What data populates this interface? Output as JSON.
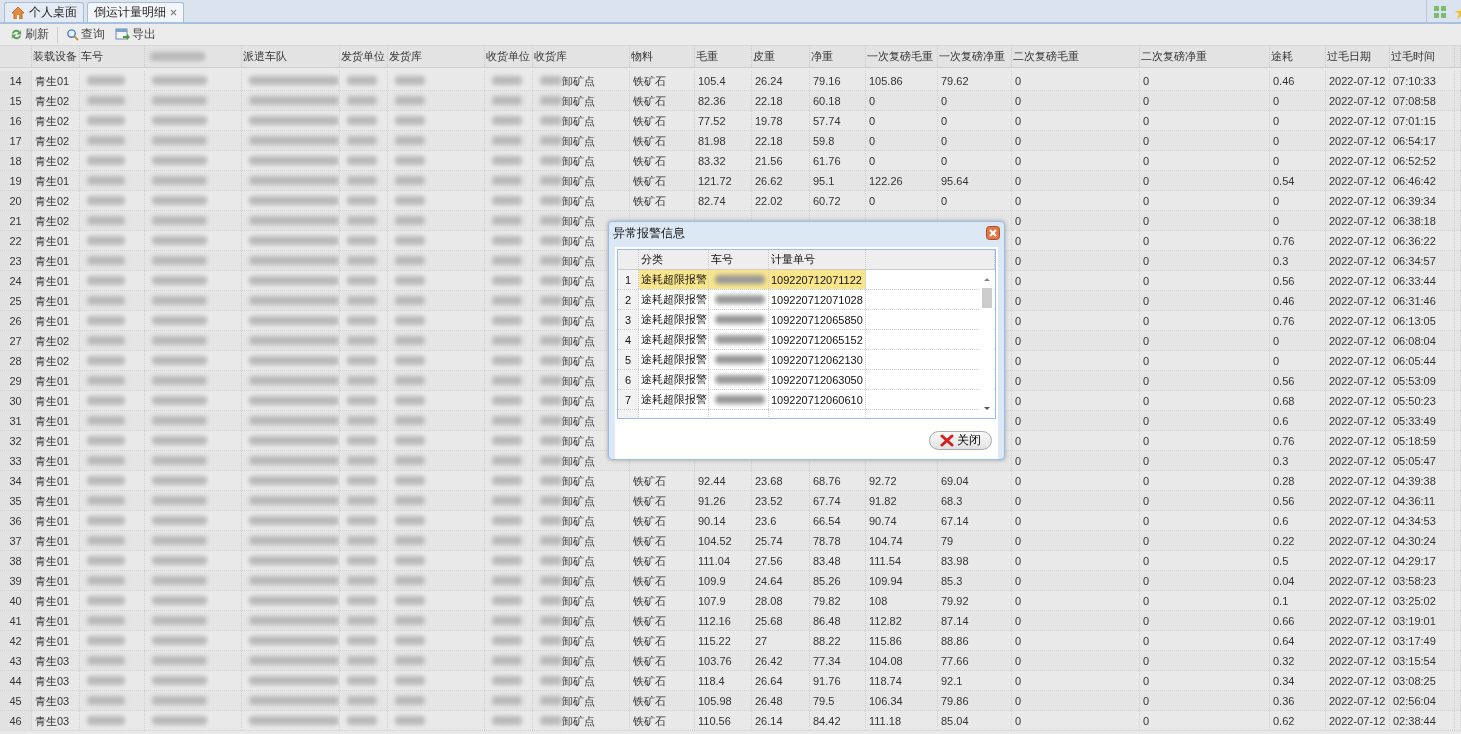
{
  "tabs": [
    {
      "label": "个人桌面",
      "selected": false
    },
    {
      "label": "倒运计量明细",
      "selected": true,
      "closable": true
    }
  ],
  "toolbar": [
    "刷新",
    "查询",
    "导出"
  ],
  "table": {
    "columns": [
      {
        "kind": "rownum"
      },
      {
        "kind": "text",
        "label": "装载设备"
      },
      {
        "kind": "blurred",
        "label": "车号"
      },
      {
        "kind": "blurred"
      },
      {
        "kind": "blurred",
        "label": "派遣车队"
      },
      {
        "kind": "blurred",
        "label": "发货单位"
      },
      {
        "kind": "blurred",
        "label": "发货库"
      },
      {
        "kind": "blurred",
        "label": "收货单位"
      },
      {
        "kind": "suffix",
        "label": "收货库"
      },
      {
        "kind": "text",
        "label": "物料"
      },
      {
        "kind": "text",
        "label": "毛重"
      },
      {
        "kind": "text",
        "label": "皮重"
      },
      {
        "kind": "text",
        "label": "净重"
      },
      {
        "kind": "text",
        "label": "一次复磅毛重"
      },
      {
        "kind": "text",
        "label": "一次复磅净重"
      },
      {
        "kind": "text",
        "label": "二次复磅毛重"
      },
      {
        "kind": "text",
        "label": "二次复磅净重"
      },
      {
        "kind": "text",
        "label": "途耗"
      },
      {
        "kind": "text",
        "label": "过毛日期"
      },
      {
        "kind": "text",
        "label": "过毛时间"
      }
    ],
    "rows": [
      {
        "cells": [
          "14",
          "青生01",
          null,
          null,
          null,
          null,
          null,
          null,
          "卸矿点",
          "铁矿石",
          "105.4",
          "26.24",
          "79.16",
          "105.86",
          "79.62",
          "0",
          "0",
          "0.46",
          "2022-07-12",
          "07:10:33"
        ]
      },
      {
        "cells": [
          "15",
          "青生02",
          null,
          null,
          null,
          null,
          null,
          null,
          "卸矿点",
          "铁矿石",
          "82.36",
          "22.18",
          "60.18",
          "0",
          "0",
          "0",
          "0",
          "0",
          "2022-07-12",
          "07:08:58"
        ]
      },
      {
        "cells": [
          "16",
          "青生02",
          null,
          null,
          null,
          null,
          null,
          null,
          "卸矿点",
          "铁矿石",
          "77.52",
          "19.78",
          "57.74",
          "0",
          "0",
          "0",
          "0",
          "0",
          "2022-07-12",
          "07:01:15"
        ]
      },
      {
        "cells": [
          "17",
          "青生02",
          null,
          null,
          null,
          null,
          null,
          null,
          "卸矿点",
          "铁矿石",
          "81.98",
          "22.18",
          "59.8",
          "0",
          "0",
          "0",
          "0",
          "0",
          "2022-07-12",
          "06:54:17"
        ]
      },
      {
        "cells": [
          "18",
          "青生02",
          null,
          null,
          null,
          null,
          null,
          null,
          "卸矿点",
          "铁矿石",
          "83.32",
          "21.56",
          "61.76",
          "0",
          "0",
          "0",
          "0",
          "0",
          "2022-07-12",
          "06:52:52"
        ]
      },
      {
        "cells": [
          "19",
          "青生01",
          null,
          null,
          null,
          null,
          null,
          null,
          "卸矿点",
          "铁矿石",
          "121.72",
          "26.62",
          "95.1",
          "122.26",
          "95.64",
          "0",
          "0",
          "0.54",
          "2022-07-12",
          "06:46:42"
        ]
      },
      {
        "cells": [
          "20",
          "青生02",
          null,
          null,
          null,
          null,
          null,
          null,
          "卸矿点",
          "铁矿石",
          "82.74",
          "22.02",
          "60.72",
          "0",
          "0",
          "0",
          "0",
          "0",
          "2022-07-12",
          "06:39:34"
        ]
      },
      {
        "cells": [
          "21",
          "青生02",
          null,
          null,
          null,
          null,
          null,
          null,
          "卸矿点",
          null,
          null,
          null,
          null,
          null,
          null,
          "0",
          "0",
          "0",
          "2022-07-12",
          "06:38:18"
        ]
      },
      {
        "cells": [
          "22",
          "青生01",
          null,
          null,
          null,
          null,
          null,
          null,
          "卸矿点",
          null,
          null,
          null,
          null,
          null,
          null,
          "0",
          "0",
          "0.76",
          "2022-07-12",
          "06:36:22"
        ]
      },
      {
        "cells": [
          "23",
          "青生01",
          null,
          null,
          null,
          null,
          null,
          null,
          "卸矿点",
          null,
          null,
          null,
          null,
          null,
          null,
          "0",
          "0",
          "0.3",
          "2022-07-12",
          "06:34:57"
        ]
      },
      {
        "cells": [
          "24",
          "青生01",
          null,
          null,
          null,
          null,
          null,
          null,
          "卸矿点",
          null,
          null,
          null,
          null,
          null,
          null,
          "0",
          "0",
          "0.56",
          "2022-07-12",
          "06:33:44"
        ]
      },
      {
        "cells": [
          "25",
          "青生01",
          null,
          null,
          null,
          null,
          null,
          null,
          "卸矿点",
          null,
          null,
          null,
          null,
          null,
          null,
          "0",
          "0",
          "0.46",
          "2022-07-12",
          "06:31:46"
        ]
      },
      {
        "cells": [
          "26",
          "青生01",
          null,
          null,
          null,
          null,
          null,
          null,
          "卸矿点",
          null,
          null,
          null,
          null,
          null,
          null,
          "0",
          "0",
          "0.76",
          "2022-07-12",
          "06:13:05"
        ]
      },
      {
        "cells": [
          "27",
          "青生02",
          null,
          null,
          null,
          null,
          null,
          null,
          "卸矿点",
          null,
          null,
          null,
          null,
          null,
          null,
          "0",
          "0",
          "0",
          "2022-07-12",
          "06:08:04"
        ]
      },
      {
        "cells": [
          "28",
          "青生02",
          null,
          null,
          null,
          null,
          null,
          null,
          "卸矿点",
          null,
          null,
          null,
          null,
          null,
          null,
          "0",
          "0",
          "0",
          "2022-07-12",
          "06:05:44"
        ]
      },
      {
        "cells": [
          "29",
          "青生01",
          null,
          null,
          null,
          null,
          null,
          null,
          "卸矿点",
          null,
          null,
          null,
          null,
          null,
          null,
          "0",
          "0",
          "0.56",
          "2022-07-12",
          "05:53:09"
        ]
      },
      {
        "cells": [
          "30",
          "青生01",
          null,
          null,
          null,
          null,
          null,
          null,
          "卸矿点",
          null,
          null,
          null,
          null,
          null,
          null,
          "0",
          "0",
          "0.68",
          "2022-07-12",
          "05:50:23"
        ]
      },
      {
        "cells": [
          "31",
          "青生01",
          null,
          null,
          null,
          null,
          null,
          null,
          "卸矿点",
          null,
          null,
          null,
          null,
          null,
          null,
          "0",
          "0",
          "0.6",
          "2022-07-12",
          "05:33:49"
        ]
      },
      {
        "cells": [
          "32",
          "青生01",
          null,
          null,
          null,
          null,
          null,
          null,
          "卸矿点",
          null,
          null,
          null,
          null,
          null,
          null,
          "0",
          "0",
          "0.76",
          "2022-07-12",
          "05:18:59"
        ]
      },
      {
        "cells": [
          "33",
          "青生01",
          null,
          null,
          null,
          null,
          null,
          null,
          "卸矿点",
          null,
          null,
          null,
          null,
          null,
          null,
          "0",
          "0",
          "0.3",
          "2022-07-12",
          "05:05:47"
        ]
      },
      {
        "cells": [
          "34",
          "青生01",
          null,
          null,
          null,
          null,
          null,
          null,
          "卸矿点",
          "铁矿石",
          "92.44",
          "23.68",
          "68.76",
          "92.72",
          "69.04",
          "0",
          "0",
          "0.28",
          "2022-07-12",
          "04:39:38"
        ]
      },
      {
        "cells": [
          "35",
          "青生01",
          null,
          null,
          null,
          null,
          null,
          null,
          "卸矿点",
          "铁矿石",
          "91.26",
          "23.52",
          "67.74",
          "91.82",
          "68.3",
          "0",
          "0",
          "0.56",
          "2022-07-12",
          "04:36:11"
        ]
      },
      {
        "cells": [
          "36",
          "青生01",
          null,
          null,
          null,
          null,
          null,
          null,
          "卸矿点",
          "铁矿石",
          "90.14",
          "23.6",
          "66.54",
          "90.74",
          "67.14",
          "0",
          "0",
          "0.6",
          "2022-07-12",
          "04:34:53"
        ]
      },
      {
        "cells": [
          "37",
          "青生01",
          null,
          null,
          null,
          null,
          null,
          null,
          "卸矿点",
          "铁矿石",
          "104.52",
          "25.74",
          "78.78",
          "104.74",
          "79",
          "0",
          "0",
          "0.22",
          "2022-07-12",
          "04:30:24"
        ]
      },
      {
        "cells": [
          "38",
          "青生01",
          null,
          null,
          null,
          null,
          null,
          null,
          "卸矿点",
          "铁矿石",
          "111.04",
          "27.56",
          "83.48",
          "111.54",
          "83.98",
          "0",
          "0",
          "0.5",
          "2022-07-12",
          "04:29:17"
        ]
      },
      {
        "cells": [
          "39",
          "青生01",
          null,
          null,
          null,
          null,
          null,
          null,
          "卸矿点",
          "铁矿石",
          "109.9",
          "24.64",
          "85.26",
          "109.94",
          "85.3",
          "0",
          "0",
          "0.04",
          "2022-07-12",
          "03:58:23"
        ]
      },
      {
        "cells": [
          "40",
          "青生01",
          null,
          null,
          null,
          null,
          null,
          null,
          "卸矿点",
          "铁矿石",
          "107.9",
          "28.08",
          "79.82",
          "108",
          "79.92",
          "0",
          "0",
          "0.1",
          "2022-07-12",
          "03:25:02"
        ]
      },
      {
        "cells": [
          "41",
          "青生01",
          null,
          null,
          null,
          null,
          null,
          null,
          "卸矿点",
          "铁矿石",
          "112.16",
          "25.68",
          "86.48",
          "112.82",
          "87.14",
          "0",
          "0",
          "0.66",
          "2022-07-12",
          "03:19:01"
        ]
      },
      {
        "cells": [
          "42",
          "青生01",
          null,
          null,
          null,
          null,
          null,
          null,
          "卸矿点",
          "铁矿石",
          "115.22",
          "27",
          "88.22",
          "115.86",
          "88.86",
          "0",
          "0",
          "0.64",
          "2022-07-12",
          "03:17:49"
        ]
      },
      {
        "cells": [
          "43",
          "青生03",
          null,
          null,
          null,
          null,
          null,
          null,
          "卸矿点",
          "铁矿石",
          "103.76",
          "26.42",
          "77.34",
          "104.08",
          "77.66",
          "0",
          "0",
          "0.32",
          "2022-07-12",
          "03:15:54"
        ]
      },
      {
        "cells": [
          "44",
          "青生03",
          null,
          null,
          null,
          null,
          null,
          null,
          "卸矿点",
          "铁矿石",
          "118.4",
          "26.64",
          "91.76",
          "118.74",
          "92.1",
          "0",
          "0",
          "0.34",
          "2022-07-12",
          "03:08:25"
        ]
      },
      {
        "cells": [
          "45",
          "青生03",
          null,
          null,
          null,
          null,
          null,
          null,
          "卸矿点",
          "铁矿石",
          "105.98",
          "26.48",
          "79.5",
          "106.34",
          "79.86",
          "0",
          "0",
          "0.36",
          "2022-07-12",
          "02:56:04"
        ]
      },
      {
        "cells": [
          "46",
          "青生03",
          null,
          null,
          null,
          null,
          null,
          null,
          "卸矿点",
          "铁矿石",
          "110.56",
          "26.14",
          "84.42",
          "111.18",
          "85.04",
          "0",
          "0",
          "0.62",
          "2022-07-12",
          "02:38:44"
        ]
      }
    ]
  },
  "dialog": {
    "title": "异常报警信息",
    "columns": [
      "分类",
      "车号",
      "计量单号"
    ],
    "rows": [
      {
        "no": "1",
        "category": "途耗超限报警",
        "number": "109220712071122",
        "selected": true
      },
      {
        "no": "2",
        "category": "途耗超限报警",
        "number": "109220712071028",
        "selected": false
      },
      {
        "no": "3",
        "category": "途耗超限报警",
        "number": "109220712065850",
        "selected": false
      },
      {
        "no": "4",
        "category": "途耗超限报警",
        "number": "109220712065152",
        "selected": false
      },
      {
        "no": "5",
        "category": "途耗超限报警",
        "number": "109220712062130",
        "selected": false
      },
      {
        "no": "6",
        "category": "途耗超限报警",
        "number": "109220712063050",
        "selected": false
      },
      {
        "no": "7",
        "category": "途耗超限报警",
        "number": "109220712060610",
        "selected": false
      }
    ],
    "button": "关闭"
  }
}
